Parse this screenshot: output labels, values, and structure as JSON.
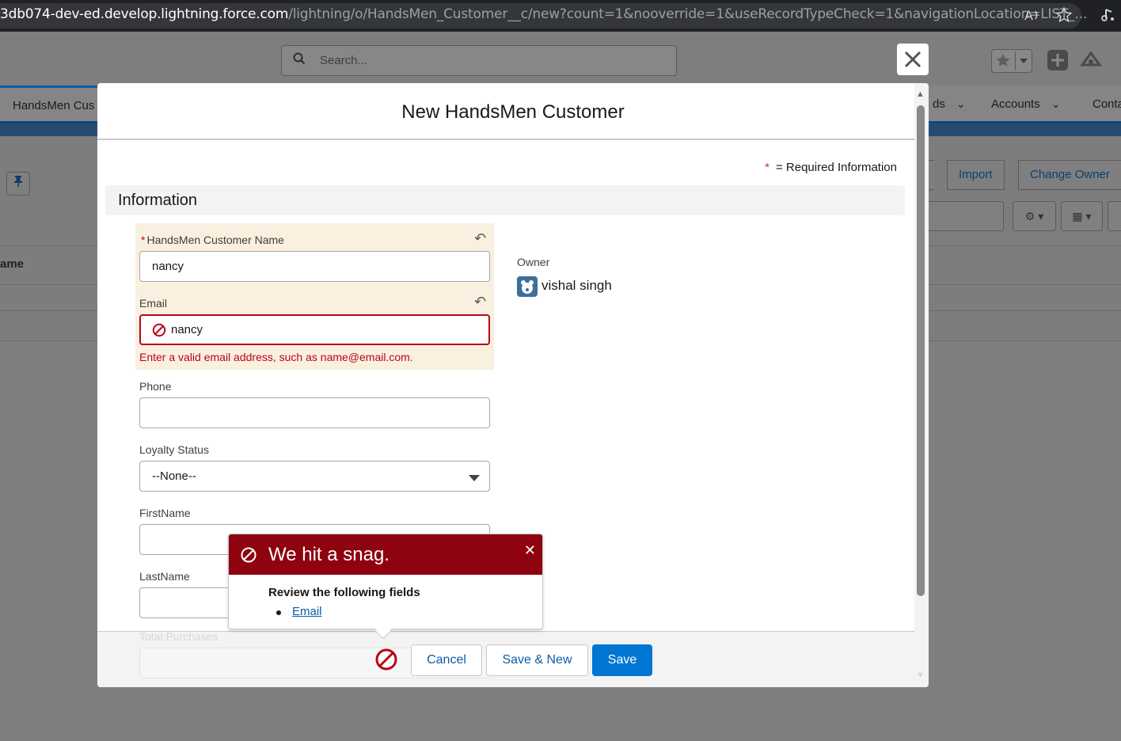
{
  "browser": {
    "url_domain": "3db074-dev-ed.develop.lightning.force.com",
    "url_path": "/lightning/o/HandsMen_Customer__c/new?count=1&nooverride=1&useRecordTypeCheck=1&navigationLocation=LIST_..."
  },
  "app": {
    "search_placeholder": "Search...",
    "nav": {
      "current_tab": "HandsMen Cus",
      "items": [
        "ds",
        "Accounts",
        "Conta"
      ]
    },
    "list_actions": [
      "Import",
      "Change Owner"
    ],
    "column_header": "ame"
  },
  "modal": {
    "title": "New HandsMen Customer",
    "required_note": "= Required Information",
    "required_star": "*",
    "section_title": "Information",
    "fields": {
      "name": {
        "label": "HandsMen Customer Name",
        "required_marker": "*",
        "value": "nancy"
      },
      "email": {
        "label": "Email",
        "value": "nancy",
        "error": "Enter a valid email address, such as name@email.com."
      },
      "phone": {
        "label": "Phone",
        "value": ""
      },
      "loyalty": {
        "label": "Loyalty Status",
        "value": "--None--"
      },
      "firstname": {
        "label": "FirstName",
        "value": ""
      },
      "lastname": {
        "label": "LastName",
        "value": ""
      },
      "total_purchases": {
        "label": "Total Purchases"
      }
    },
    "owner": {
      "label": "Owner",
      "name": "vishal singh"
    },
    "buttons": {
      "cancel": "Cancel",
      "save_new": "Save & New",
      "save": "Save"
    }
  },
  "error_popover": {
    "title": "We hit a snag.",
    "subtitle": "Review the following fields",
    "fields": [
      "Email"
    ]
  },
  "colors": {
    "error_red": "#ba0517",
    "popover_header": "#8e030f",
    "brand_blue": "#0176d3",
    "changed_field_bg": "#faf0e0"
  }
}
